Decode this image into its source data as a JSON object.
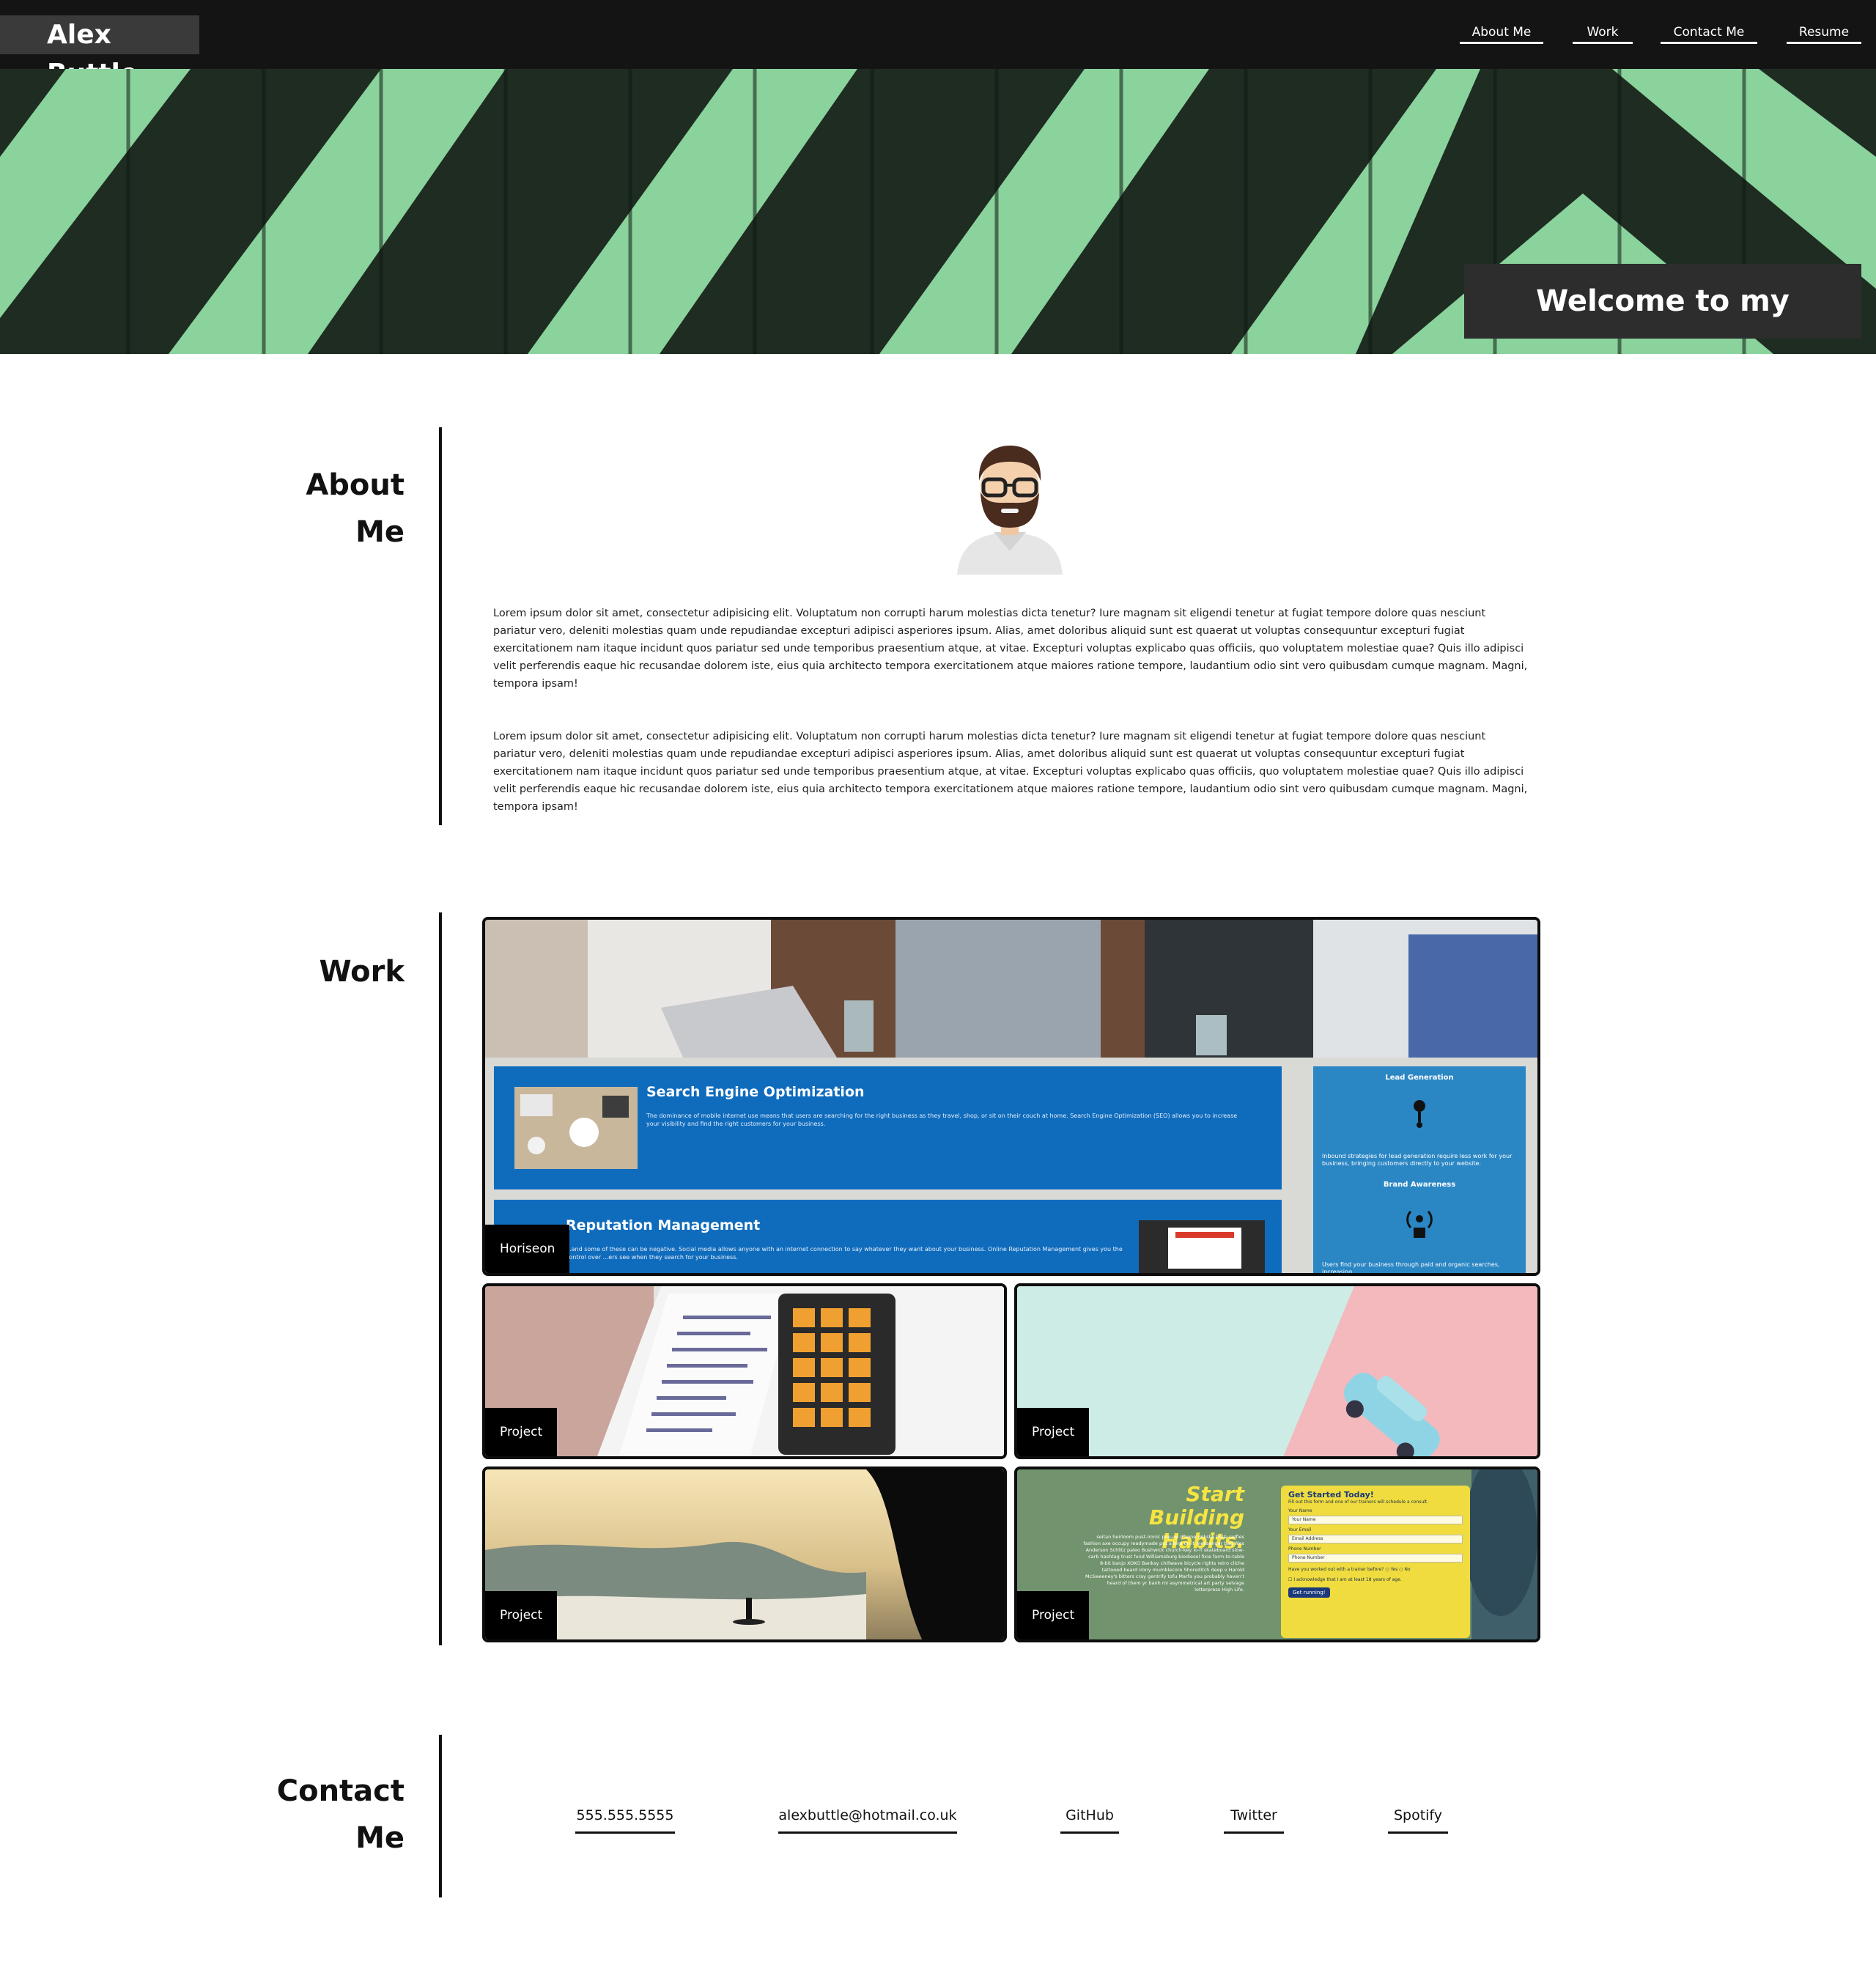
{
  "header": {
    "brand": "Alex Buttle",
    "nav": [
      "About Me",
      "Work",
      "Contact Me",
      "Resume"
    ]
  },
  "hero": {
    "title": "Welcome to my portfolio!"
  },
  "about": {
    "title_line1": "About",
    "title_line2": "Me",
    "paragraphs": [
      "Lorem ipsum dolor sit amet, consectetur adipisicing elit. Voluptatum non corrupti harum molestias dicta tenetur? Iure magnam sit eligendi tenetur at fugiat tempore dolore quas nesciunt pariatur vero, deleniti molestias quam unde repudiandae excepturi adipisci asperiores ipsum. Alias, amet doloribus aliquid sunt est quaerat ut voluptas consequuntur excepturi fugiat exercitationem nam itaque incidunt quos pariatur sed unde temporibus praesentium atque, at vitae. Excepturi voluptas explicabo quas officiis, quo voluptatem molestiae quae? Quis illo adipisci velit perferendis eaque hic recusandae dolorem iste, eius quia architecto tempora exercitationem atque maiores ratione tempore, laudantium odio sint vero quibusdam cumque magnam. Magni, tempora ipsam!",
      "Lorem ipsum dolor sit amet, consectetur adipisicing elit. Voluptatum non corrupti harum molestias dicta tenetur? Iure magnam sit eligendi tenetur at fugiat tempore dolore quas nesciunt pariatur vero, deleniti molestias quam unde repudiandae excepturi adipisci asperiores ipsum. Alias, amet doloribus aliquid sunt est quaerat ut voluptas consequuntur excepturi fugiat exercitationem nam itaque incidunt quos pariatur sed unde temporibus praesentium atque, at vitae. Excepturi voluptas explicabo quas officiis, quo voluptatem molestiae quae? Quis illo adipisci velit perferendis eaque hic recusandae dolorem iste, eius quia architecto tempora exercitationem atque maiores ratione tempore, laudantium odio sint vero quibusdam cumque magnam. Magni, tempora ipsam!"
    ]
  },
  "work": {
    "title": "Work",
    "featured": {
      "label": "Horiseon",
      "seo_title": "Search Engine Optimization",
      "seo_text": "The dominance of mobile internet use means that users are searching for the right business as they travel, shop, or sit on their couch at home. Search Engine Optimization (SEO) allows you to increase your visibility and find the right customers for your business.",
      "rep_title": "Reputation Management",
      "rep_text": "...and some of these can be negative. Social media allows anyone with an internet connection to say whatever they want about your business. Online Reputation Management gives you the control over ...ers see when they search for your business.",
      "side_title1": "Lead Generation",
      "side_text1": "Inbound strategies for lead generation require less work for your business, bringing customers directly to your website.",
      "side_title2": "Brand Awareness",
      "side_text2": "Users find your business through paid and organic searches, increasing"
    },
    "projects": [
      "Project",
      "Project",
      "Project",
      "Project"
    ],
    "habits": {
      "title": "Start Building Habits.",
      "body": "seitan heirloom pust-ironic pop-up iPhone mlkshk hella selfies fashion axe occupy readymade put a bird on it messenger bag Wes Anderson Schlitz paleo Bushwick church-key lo-fi skateboard slow-carb hashtag trust fund Williamsburg biodiesel fixie farm-to-table 8-bit banjo XOXO Banksy chillwave bicycle rights retro cliche tattooed beard irony mumblecore Shoreditch deep v Harold McSweeney's bitters cray gentrify tofu Marfa you probably haven't heard of them yr banh mi asymmetrical art party selvage letterpress High Life.",
      "form_title": "Get Started Today!",
      "form_sub": "Fill out this form and one of our trainers will schedule a consult.",
      "name_label": "Your Name",
      "name_ph": "Your Name",
      "email_label": "Your Email",
      "email_ph": "Email Address",
      "phone_label": "Phone Number",
      "phone_ph": "Phone Number",
      "trainer_q": "Have you worked out with a trainer before?",
      "yes": "Yes",
      "no": "No",
      "ack": "I acknowledge that I am at least 18 years of age.",
      "button": "Get running!"
    }
  },
  "contact": {
    "title_line1": "Contact",
    "title_line2": "Me",
    "links": [
      "555.555.5555",
      "alexbuttle@hotmail.co.uk",
      "GitHub",
      "Twitter",
      "Spotify"
    ]
  },
  "colors": {
    "header_bg": "#141414",
    "hero_green": "#8ad39c",
    "hero_dark": "#1f2c22",
    "horiseon_blue": "#0f6cbd"
  }
}
